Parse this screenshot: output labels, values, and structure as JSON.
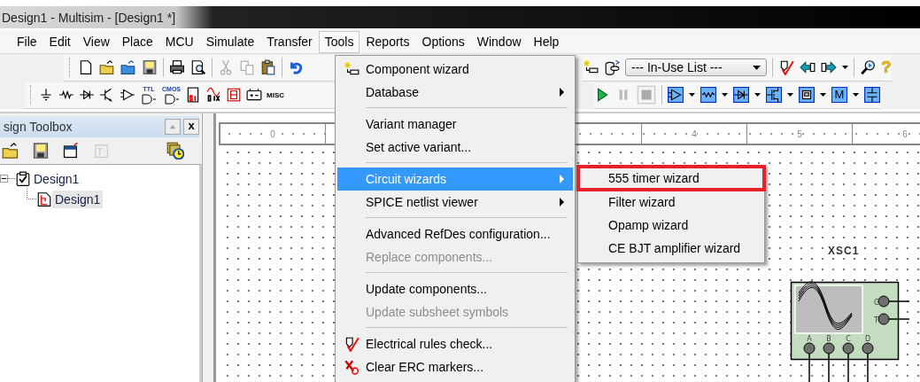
{
  "window": {
    "title": "Design1 - Multisim - [Design1 *]"
  },
  "menu_bar": [
    {
      "label": "File",
      "selected": false
    },
    {
      "label": "Edit",
      "selected": false
    },
    {
      "label": "View",
      "selected": false
    },
    {
      "label": "Place",
      "selected": false
    },
    {
      "label": "MCU",
      "selected": false
    },
    {
      "label": "Simulate",
      "selected": false
    },
    {
      "label": "Transfer",
      "selected": false
    },
    {
      "label": "Tools",
      "selected": true
    },
    {
      "label": "Reports",
      "selected": false
    },
    {
      "label": "Options",
      "selected": false
    },
    {
      "label": "Window",
      "selected": false
    },
    {
      "label": "Help",
      "selected": false
    }
  ],
  "toolbar": {
    "list_dropdown": "--- In-Use List ---",
    "help": "?"
  },
  "components_toolbar": {
    "gate_labels": [
      "TTL",
      "CMOS"
    ],
    "misc_label": "MISC",
    "mcu_label": "M"
  },
  "design_toolbox": {
    "title": "sign Toolbox",
    "close": "x",
    "tree": [
      {
        "label": "Design1",
        "expanded": true,
        "selected": false,
        "children": [
          {
            "label": "Design1",
            "selected": true
          }
        ]
      }
    ]
  },
  "canvas": {
    "ruler_labels": [
      "0",
      "4",
      "5",
      "6"
    ],
    "instrument": {
      "refdes": "XSC1",
      "pins": [
        {
          "label": "G",
          "kind": "right"
        },
        {
          "label": "T",
          "kind": "right"
        },
        {
          "label": "A",
          "kind": "bottom"
        },
        {
          "label": "B",
          "kind": "bottom"
        },
        {
          "label": "C",
          "kind": "bottom"
        },
        {
          "label": "D",
          "kind": "bottom"
        }
      ]
    }
  },
  "tools_menu": {
    "items": [
      {
        "kind": "item",
        "label": "Component wizard",
        "submenu": false,
        "disabled": false,
        "selected": false
      },
      {
        "kind": "item",
        "label": "Database",
        "submenu": true,
        "disabled": false,
        "selected": false
      },
      {
        "kind": "separator"
      },
      {
        "kind": "item",
        "label": "Variant manager",
        "submenu": false,
        "disabled": false,
        "selected": false
      },
      {
        "kind": "item",
        "label": "Set active variant...",
        "submenu": false,
        "disabled": false,
        "selected": false
      },
      {
        "kind": "separator"
      },
      {
        "kind": "item",
        "label": "Circuit wizards",
        "submenu": true,
        "disabled": false,
        "selected": true
      },
      {
        "kind": "item",
        "label": "SPICE netlist viewer",
        "submenu": true,
        "disabled": false,
        "selected": false
      },
      {
        "kind": "separator"
      },
      {
        "kind": "item",
        "label": "Advanced RefDes configuration...",
        "submenu": false,
        "disabled": false,
        "selected": false
      },
      {
        "kind": "item",
        "label": "Replace components...",
        "submenu": false,
        "disabled": true,
        "selected": false
      },
      {
        "kind": "separator"
      },
      {
        "kind": "item",
        "label": "Update components...",
        "submenu": false,
        "disabled": false,
        "selected": false
      },
      {
        "kind": "item",
        "label": "Update subsheet symbols",
        "submenu": false,
        "disabled": true,
        "selected": false
      },
      {
        "kind": "separator"
      },
      {
        "kind": "item",
        "label": "Electrical rules check...",
        "submenu": false,
        "disabled": false,
        "selected": false
      },
      {
        "kind": "item",
        "label": "Clear ERC markers...",
        "submenu": false,
        "disabled": false,
        "selected": false
      }
    ]
  },
  "circuit_wizards_menu": {
    "items": [
      {
        "label": "555 timer wizard",
        "framed": true,
        "selected": false
      },
      {
        "label": "Filter wizard",
        "framed": false,
        "selected": false
      },
      {
        "label": "Opamp wizard",
        "framed": false,
        "selected": false
      },
      {
        "label": "CE BJT amplifier wizard",
        "framed": false,
        "selected": false
      }
    ]
  }
}
